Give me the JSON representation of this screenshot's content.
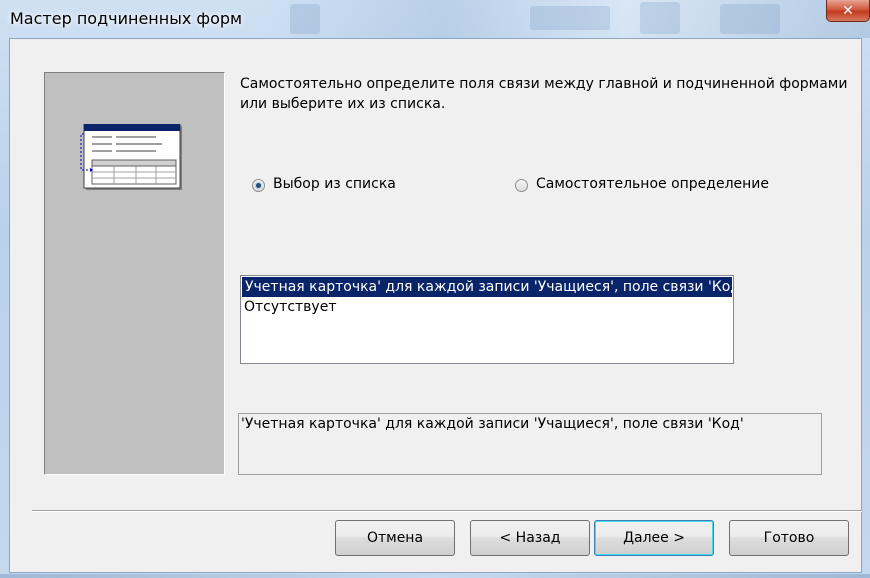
{
  "window": {
    "title": "Мастер подчиненных форм",
    "close_glyph": "✕"
  },
  "instructions": {
    "line1": "Самостоятельно определите поля связи между главной и подчиненной формами",
    "line2": " или выберите их из списка."
  },
  "options": {
    "choose_from_list": "Выбор из списка",
    "define_own": "Самостоятельное определение",
    "selected": "choose_from_list"
  },
  "list": {
    "items": [
      "Учетная карточка' для каждой записи 'Учащиеся', поле связи 'Код",
      "Отсутствует"
    ],
    "selected_index": 0
  },
  "description": "'Учетная карточка' для каждой записи 'Учащиеся', поле связи 'Код'",
  "buttons": {
    "cancel": "Отмена",
    "back": "< Назад",
    "next": "Далее >",
    "finish": "Готово"
  },
  "icons": {
    "illustration": "subform-wizard-illustration-icon",
    "close": "close-icon"
  },
  "colors": {
    "selection": "#0a246a",
    "panel": "#c0c0c0",
    "client": "#f0f0f0"
  }
}
